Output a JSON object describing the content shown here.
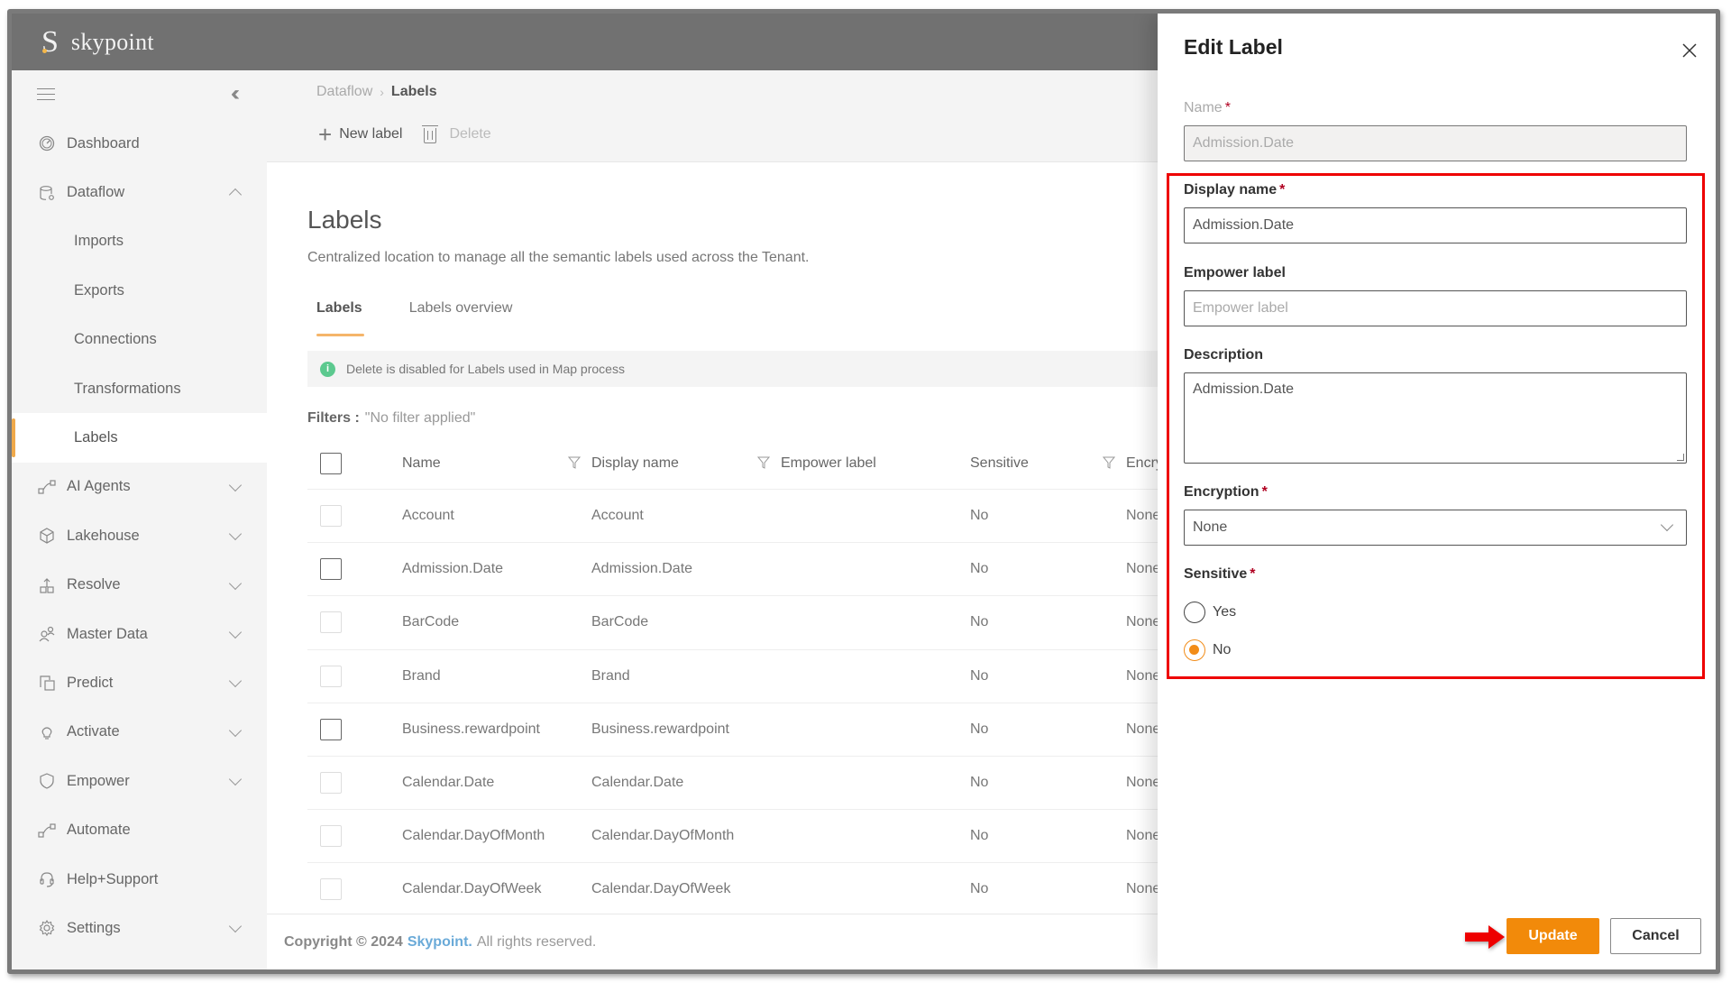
{
  "app": {
    "brand_letter": "S",
    "brand_name": "skypoint"
  },
  "sidebar": {
    "items": [
      {
        "label": "Dashboard",
        "icon": "dashboard-icon",
        "expandable": false
      },
      {
        "label": "Dataflow",
        "icon": "database-gear-icon",
        "expandable": true,
        "expanded": true,
        "children": [
          {
            "label": "Imports"
          },
          {
            "label": "Exports"
          },
          {
            "label": "Connections"
          },
          {
            "label": "Transformations"
          },
          {
            "label": "Labels",
            "active": true
          }
        ]
      },
      {
        "label": "AI Agents",
        "icon": "flow-icon",
        "expandable": true
      },
      {
        "label": "Lakehouse",
        "icon": "cube-icon",
        "expandable": true
      },
      {
        "label": "Resolve",
        "icon": "resolve-icon",
        "expandable": true
      },
      {
        "label": "Master Data",
        "icon": "people-icon",
        "expandable": true
      },
      {
        "label": "Predict",
        "icon": "predict-icon",
        "expandable": true
      },
      {
        "label": "Activate",
        "icon": "lightbulb-icon",
        "expandable": true
      },
      {
        "label": "Empower",
        "icon": "shield-icon",
        "expandable": true
      },
      {
        "label": "Automate",
        "icon": "flow-icon",
        "expandable": false
      },
      {
        "label": "Help+Support",
        "icon": "headset-icon",
        "expandable": false
      },
      {
        "label": "Settings",
        "icon": "gear-icon",
        "expandable": true
      }
    ]
  },
  "breadcrumb": {
    "parent": "Dataflow",
    "current": "Labels"
  },
  "toolbar": {
    "new_label": "New label",
    "delete_label": "Delete"
  },
  "page": {
    "title": "Labels",
    "description": "Centralized location to manage all the semantic labels used across the Tenant.",
    "tabs": [
      {
        "label": "Labels",
        "active": true
      },
      {
        "label": "Labels overview",
        "active": false
      }
    ],
    "info_message": "Delete is disabled for Labels used in Map process",
    "filters_label": "Filters :",
    "filters_value": "\"No filter applied\""
  },
  "table": {
    "columns": [
      "Name",
      "Display name",
      "Empower label",
      "Sensitive",
      "Encrypt"
    ],
    "rows": [
      {
        "name": "Account",
        "display_name": "Account",
        "empower_label": "",
        "sensitive": "No",
        "encryption": "None"
      },
      {
        "name": "Admission.Date",
        "display_name": "Admission.Date",
        "empower_label": "",
        "sensitive": "No",
        "encryption": "None"
      },
      {
        "name": "BarCode",
        "display_name": "BarCode",
        "empower_label": "",
        "sensitive": "No",
        "encryption": "None"
      },
      {
        "name": "Brand",
        "display_name": "Brand",
        "empower_label": "",
        "sensitive": "No",
        "encryption": "None"
      },
      {
        "name": "Business.rewardpoint",
        "display_name": "Business.rewardpoint",
        "empower_label": "",
        "sensitive": "No",
        "encryption": "None"
      },
      {
        "name": "Calendar.Date",
        "display_name": "Calendar.Date",
        "empower_label": "",
        "sensitive": "No",
        "encryption": "None"
      },
      {
        "name": "Calendar.DayOfMonth",
        "display_name": "Calendar.DayOfMonth",
        "empower_label": "",
        "sensitive": "No",
        "encryption": "None"
      },
      {
        "name": "Calendar.DayOfWeek",
        "display_name": "Calendar.DayOfWeek",
        "empower_label": "",
        "sensitive": "No",
        "encryption": "None"
      }
    ]
  },
  "footer": {
    "copyright": "Copyright © 2024",
    "brand": "Skypoint.",
    "rest": "All rights reserved."
  },
  "edit_panel": {
    "title": "Edit Label",
    "name_label": "Name",
    "name_value": "Admission.Date",
    "display_name_label": "Display name",
    "display_name_value": "Admission.Date",
    "empower_label_label": "Empower label",
    "empower_label_value": "",
    "empower_label_placeholder": "Empower label",
    "description_label": "Description",
    "description_value": "Admission.Date",
    "encryption_label": "Encryption",
    "encryption_value": "None",
    "sensitive_label": "Sensitive",
    "sensitive_options": [
      "Yes",
      "No"
    ],
    "sensitive_selected": "No",
    "required_mark": "*",
    "update_label": "Update",
    "cancel_label": "Cancel"
  },
  "colors": {
    "accent": "#f28a0a",
    "highlight": "#ee0000",
    "link": "#6aaad8",
    "topbar": "#717171"
  }
}
